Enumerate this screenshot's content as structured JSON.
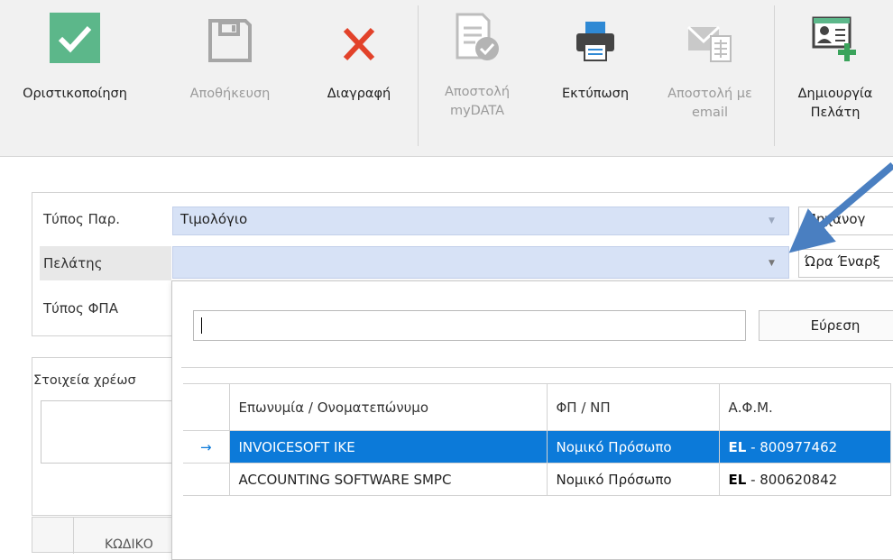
{
  "ribbon": {
    "finalize_label": "Οριστικοποίηση",
    "save_label": "Αποθήκευση",
    "delete_label": "Διαγραφή",
    "send_mydata_label": "Αποστολή myDATA",
    "print_label": "Εκτύπωση",
    "send_email_label": "Αποστολή με email",
    "create_customer_label": "Δημιουργία Πελάτη"
  },
  "form": {
    "doc_type_label": "Τύπος Παρ.",
    "doc_type_value": "Τιμολόγιο",
    "customer_label": "Πελάτης",
    "customer_value": "",
    "vat_type_label": "Τύπος ΦΠΑ",
    "side_box_1": "Μηχανογ",
    "side_box_2": "Ώρα Έναρξ",
    "billing_label": "Στοιχεία χρέωσ",
    "grid_col_code": "ΚΩΔΙΚΟ"
  },
  "popup": {
    "search_value": "",
    "search_button": "Εύρεση",
    "columns": {
      "name": "Επωνυμία / Ονοματεπώνυμο",
      "type": "ΦΠ / ΝΠ",
      "afm": "Α.Φ.Μ."
    },
    "rows": [
      {
        "indicator": "→",
        "name": "INVOICESOFT IKE",
        "type": "Νομικό Πρόσωπο",
        "afm_prefix": "EL",
        "afm_sep": " - ",
        "afm": "800977462",
        "selected": true
      },
      {
        "indicator": "",
        "name": "ACCOUNTING SOFTWARE SMPC",
        "type": "Νομικό Πρόσωπο",
        "afm_prefix": "EL",
        "afm_sep": " - ",
        "afm": "800620842",
        "selected": false
      }
    ]
  },
  "colors": {
    "accent_green": "#5cb78a",
    "delete_red": "#e2422a",
    "selection_blue": "#0c7ad9",
    "field_blue": "#d7e2f6",
    "annotation_arrow": "#4a7fc1"
  }
}
